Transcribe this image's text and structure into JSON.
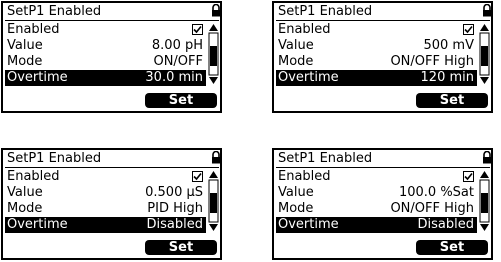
{
  "screens": [
    {
      "title": "SetP1 Enabled",
      "rows": [
        {
          "label": "Enabled",
          "value": ""
        },
        {
          "label": "Value",
          "value": "8.00 pH"
        },
        {
          "label": "Mode",
          "value": "ON/OFF"
        },
        {
          "label": "Overtime",
          "value": "30.0 min"
        }
      ],
      "button": "Set"
    },
    {
      "title": "SetP1 Enabled",
      "rows": [
        {
          "label": "Enabled",
          "value": ""
        },
        {
          "label": "Value",
          "value": "500 mV"
        },
        {
          "label": "Mode",
          "value": "ON/OFF High"
        },
        {
          "label": "Overtime",
          "value": "120 min"
        }
      ],
      "button": "Set"
    },
    {
      "title": "SetP1 Enabled",
      "rows": [
        {
          "label": "Enabled",
          "value": ""
        },
        {
          "label": "Value",
          "value": "0.500 µS"
        },
        {
          "label": "Mode",
          "value": "PID High"
        },
        {
          "label": "Overtime",
          "value": "Disabled"
        }
      ],
      "button": "Set"
    },
    {
      "title": "SetP1 Enabled",
      "rows": [
        {
          "label": "Enabled",
          "value": ""
        },
        {
          "label": "Value",
          "value": "100.0 %Sat"
        },
        {
          "label": "Mode",
          "value": "ON/OFF High"
        },
        {
          "label": "Overtime",
          "value": "Disabled"
        }
      ],
      "button": "Set"
    }
  ],
  "icons": {
    "lock": "lock-icon",
    "checkbox": "checked-checkbox-icon",
    "scroll_up": "scroll-up-arrow-icon",
    "scroll_down": "scroll-down-arrow-icon"
  }
}
